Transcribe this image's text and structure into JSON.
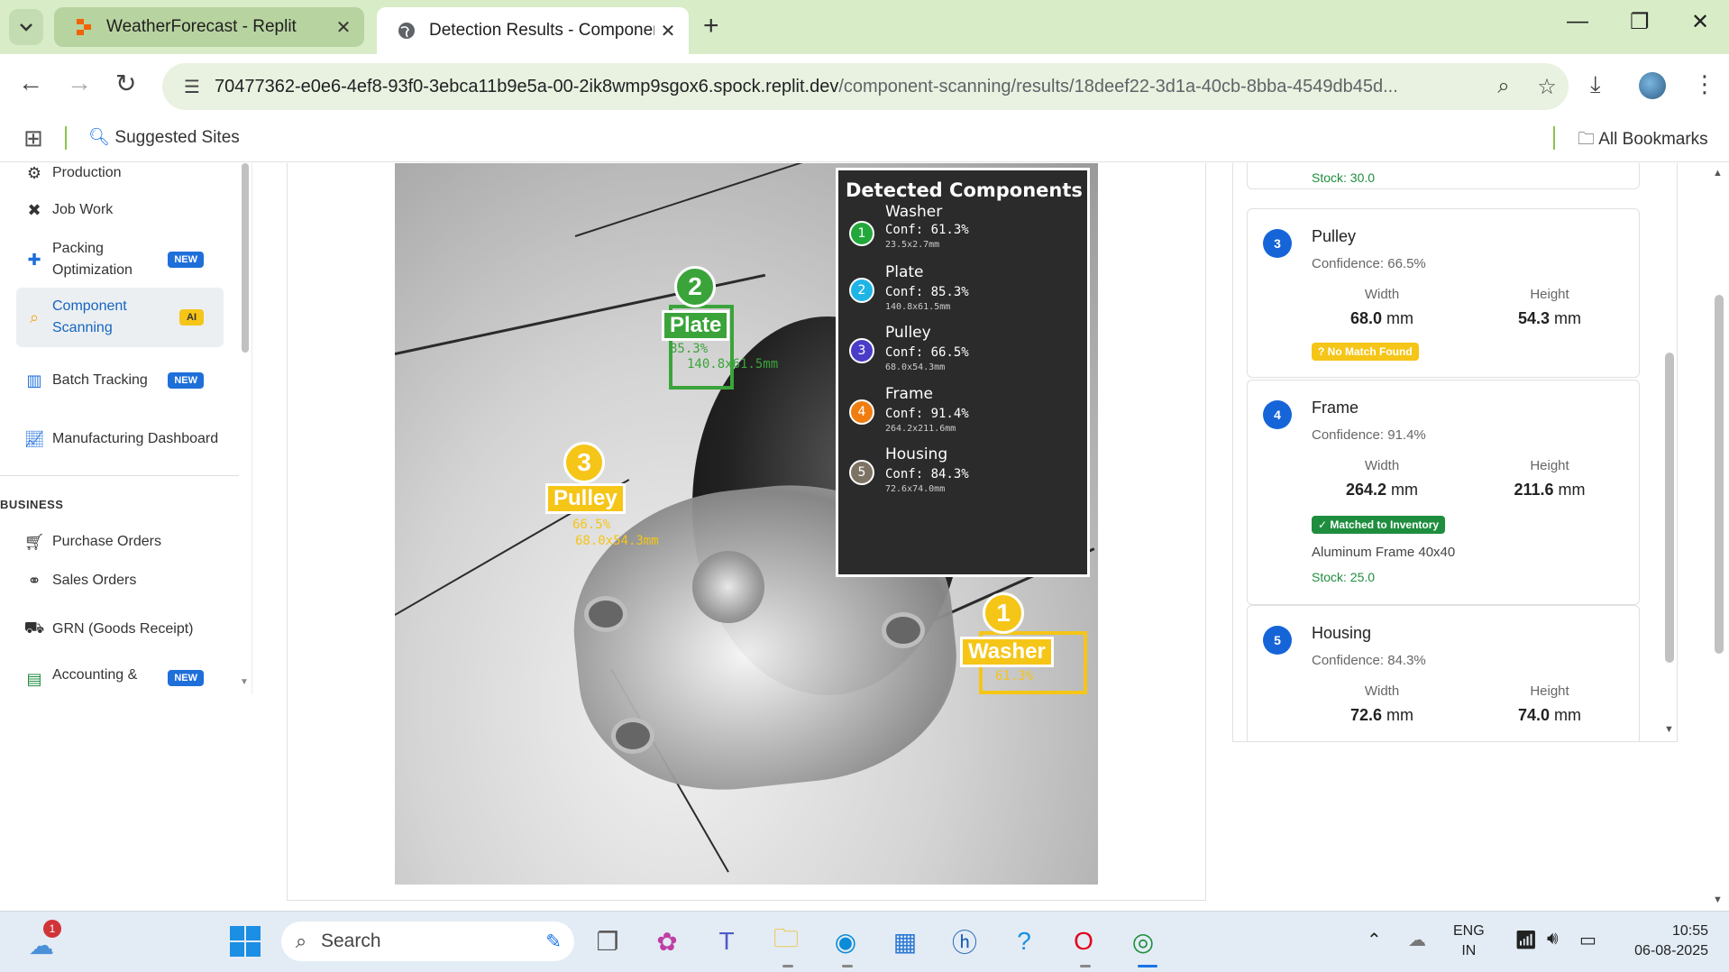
{
  "browser": {
    "tabs": [
      {
        "title": "WeatherForecast - Replit",
        "active": false
      },
      {
        "title": "Detection Results - Component",
        "active": true
      }
    ],
    "url_host": "70477362-e0e6-4ef8-93f0-3ebca11b9e5a-00-2ik8wmp9sgox6.spock.replit.dev",
    "url_path": "/component-scanning/results/18deef22-3d1a-40cb-8bba-4549db45d...",
    "bookmarks": {
      "suggested": "Suggested Sites",
      "all": "All Bookmarks"
    }
  },
  "sidebar": {
    "items": [
      {
        "label": "Production",
        "icon": "gears-icon"
      },
      {
        "label": "Job Work",
        "icon": "tools-icon"
      },
      {
        "label": "Packing Optimization",
        "badge": "NEW",
        "icon": "puzzle-icon"
      },
      {
        "label": "Component Scanning",
        "badge": "AI",
        "icon": "search-icon",
        "active": true
      },
      {
        "label": "Batch Tracking",
        "badge": "NEW",
        "icon": "barcode-icon"
      },
      {
        "label": "Manufacturing Dashboard",
        "icon": "chart-icon"
      }
    ],
    "section": "BUSINESS",
    "business_items": [
      {
        "label": "Purchase Orders",
        "icon": "cart-icon"
      },
      {
        "label": "Sales Orders",
        "icon": "handshake-icon"
      },
      {
        "label": "GRN (Goods Receipt)",
        "icon": "truck-icon"
      },
      {
        "label": "Accounting &",
        "badge": "NEW",
        "icon": "ledger-icon"
      }
    ]
  },
  "detection_overlay": {
    "title": "Detected Components",
    "items": [
      {
        "num": "1",
        "name": "Washer",
        "conf": "Conf: 61.3%",
        "dim": "23.5x2.7mm",
        "color": "#22a83a"
      },
      {
        "num": "2",
        "name": "Plate",
        "conf": "Conf: 85.3%",
        "dim": "140.8x61.5mm",
        "color": "#1fb4e6"
      },
      {
        "num": "3",
        "name": "Pulley",
        "conf": "Conf: 66.5%",
        "dim": "68.0x54.3mm",
        "color": "#4a3cc9"
      },
      {
        "num": "4",
        "name": "Frame",
        "conf": "Conf: 91.4%",
        "dim": "264.2x211.6mm",
        "color": "#f07d10"
      },
      {
        "num": "5",
        "name": "Housing",
        "conf": "Conf: 84.3%",
        "dim": "72.6x74.0mm",
        "color": "#7d7365"
      }
    ],
    "markers": [
      {
        "num": "2",
        "label": "Plate",
        "pct": "85.3%",
        "dim": "140.8x61.5mm",
        "color": "#3aa43a"
      },
      {
        "num": "3",
        "label": "Pulley",
        "pct": "66.5%",
        "dim": "68.0x54.3mm",
        "color": "#f5c518"
      },
      {
        "num": "1",
        "label": "Washer",
        "pct": "61.3%",
        "color": "#f5c518"
      }
    ]
  },
  "results": {
    "top_stock": "Stock: 30.0",
    "cards": [
      {
        "num": "3",
        "name": "Pulley",
        "confidence": "Confidence: 66.5%",
        "width_label": "Width",
        "width_value": "68.0",
        "height_label": "Height",
        "height_value": "54.3",
        "unit": "mm",
        "status": "? No Match Found"
      },
      {
        "num": "4",
        "name": "Frame",
        "confidence": "Confidence: 91.4%",
        "width_label": "Width",
        "width_value": "264.2",
        "height_label": "Height",
        "height_value": "211.6",
        "unit": "mm",
        "status": "✓ Matched to Inventory",
        "inventory": "Aluminum Frame 40x40",
        "stock": "Stock: 25.0"
      },
      {
        "num": "5",
        "name": "Housing",
        "confidence": "Confidence: 84.3%",
        "width_label": "Width",
        "width_value": "72.6",
        "height_label": "Height",
        "height_value": "74.0",
        "unit": "mm"
      }
    ]
  },
  "taskbar": {
    "search_placeholder": "Search",
    "notification_count": "1",
    "lang_top": "ENG",
    "lang_bottom": "IN",
    "time": "10:55",
    "date": "06-08-2025"
  }
}
